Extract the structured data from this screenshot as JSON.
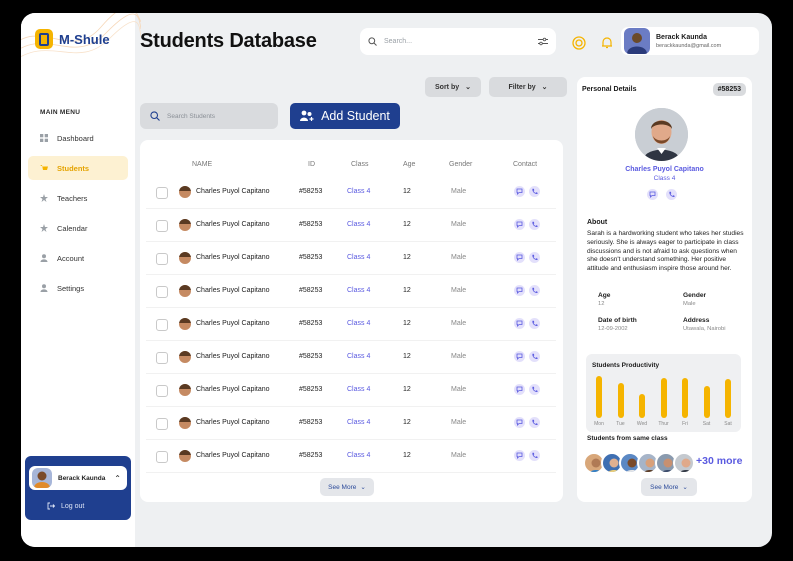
{
  "app": {
    "name": "M-Shule"
  },
  "sidebar": {
    "menu_title": "MAIN MENU",
    "items": [
      {
        "label": "Dashboard",
        "icon": "grid-icon"
      },
      {
        "label": "Students",
        "icon": "cart-icon"
      },
      {
        "label": "Teachers",
        "icon": "star-icon"
      },
      {
        "label": "Calendar",
        "icon": "star-icon"
      },
      {
        "label": "Account",
        "icon": "user-icon"
      },
      {
        "label": "Settings",
        "icon": "user-icon"
      }
    ],
    "active_index": 1,
    "user": {
      "name": "Berack Kaunda",
      "logout": "Log out"
    }
  },
  "header": {
    "title": "Students Database",
    "search_placeholder": "Search...",
    "profile": {
      "name": "Berack Kaunda",
      "email": "berackkaunda@gmail.com"
    }
  },
  "toolbar": {
    "sort_label": "Sort by",
    "filter_label": "Filter by",
    "student_search_placeholder": "Search Students",
    "add_label": "Add Student"
  },
  "table": {
    "columns": [
      "NAME",
      "ID",
      "Class",
      "Age",
      "Gender",
      "Contact"
    ],
    "rows": [
      {
        "name": "Charles Puyol Capitano",
        "id": "#58253",
        "class": "Class 4",
        "age": "12",
        "gender": "Male"
      },
      {
        "name": "Charles Puyol Capitano",
        "id": "#58253",
        "class": "Class 4",
        "age": "12",
        "gender": "Male"
      },
      {
        "name": "Charles Puyol Capitano",
        "id": "#58253",
        "class": "Class 4",
        "age": "12",
        "gender": "Male"
      },
      {
        "name": "Charles Puyol Capitano",
        "id": "#58253",
        "class": "Class 4",
        "age": "12",
        "gender": "Male"
      },
      {
        "name": "Charles Puyol Capitano",
        "id": "#58253",
        "class": "Class 4",
        "age": "12",
        "gender": "Male"
      },
      {
        "name": "Charles Puyol Capitano",
        "id": "#58253",
        "class": "Class 4",
        "age": "12",
        "gender": "Male"
      },
      {
        "name": "Charles Puyol Capitano",
        "id": "#58253",
        "class": "Class 4",
        "age": "12",
        "gender": "Male"
      },
      {
        "name": "Charles Puyol Capitano",
        "id": "#58253",
        "class": "Class 4",
        "age": "12",
        "gender": "Male"
      },
      {
        "name": "Charles Puyol Capitano",
        "id": "#58253",
        "class": "Class 4",
        "age": "12",
        "gender": "Male"
      }
    ],
    "see_more": "See More"
  },
  "details": {
    "title": "Personal Details",
    "id": "#58253",
    "name": "Charles Puyol Capitano",
    "class": "Class 4",
    "about_title": "About",
    "about": "Sarah is a hardworking student who takes her studies seriously. She is always eager to participate in class discussions and is not afraid to ask questions when she doesn't understand something. Her positive attitude and enthusiasm inspire those around her.",
    "age_label": "Age",
    "age_value": "12",
    "gender_label": "Gender",
    "gender_value": "Male",
    "dob_label": "Date of birth",
    "dob_value": "12-09-2002",
    "address_label": "Address",
    "address_value": "Utawala, Nairobi",
    "productivity_title": "Students Productivity",
    "productivity": {
      "days": [
        "Mon",
        "Tue",
        "Wed",
        "Thur",
        "Fri",
        "Sat",
        "Sat"
      ],
      "values": [
        0.95,
        0.8,
        0.55,
        0.92,
        0.92,
        0.72,
        0.88
      ]
    },
    "same_class_title": "Students from same class",
    "more_count": "+30 more",
    "see_more": "See More"
  },
  "colors": {
    "brand": "#1f3f8f",
    "accent": "#f5b400",
    "link": "#5a5ae0"
  }
}
